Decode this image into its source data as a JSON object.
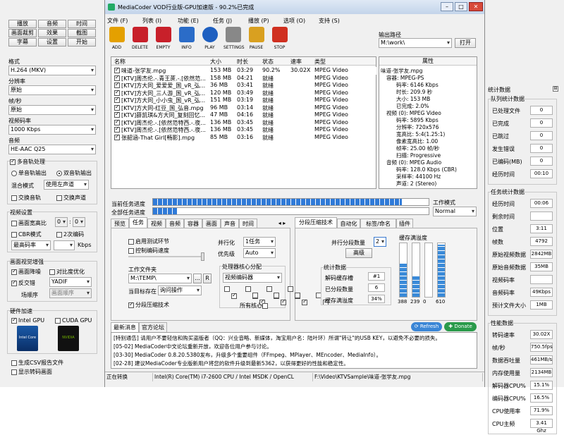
{
  "window": {
    "title": "MediaCoder VOD行业版-GPU加速版 - 90.2%已完成"
  },
  "left_buttons": [
    [
      "播放",
      "音频",
      "时间"
    ],
    [
      "画面裁剪",
      "效果",
      "截图"
    ],
    [
      "字幕",
      "设置",
      "开始"
    ]
  ],
  "format": {
    "label": "格式",
    "value": "H.264 (MKV)"
  },
  "resolution": {
    "label": "分辨率",
    "value": "原始"
  },
  "framerate": {
    "label": "帧/秒",
    "value": "原始"
  },
  "video_bitrate": {
    "label": "视频码率",
    "value": "1000 Kbps"
  },
  "audio": {
    "label": "音频",
    "value": "HE-AAC Q25"
  },
  "multitask": {
    "label": "多音轨处理",
    "single": "单音轨输出",
    "dual": "双音轨输出",
    "mix_label": "混合模式",
    "mix_value": "使用左声道",
    "swap_channel": "交换音轨",
    "swap_ch2": "交换声道"
  },
  "video_settings": {
    "title": "视频设置",
    "ratio": "画面宽高比",
    "ratio_a": "0",
    "ratio_b": "0",
    "cbr": "CBR模式",
    "pass2": "2次编码",
    "max_bitrate": "最高码率",
    "kbps": "Kbps"
  },
  "enhance": {
    "title": "画面视觉增强",
    "denoise": "画面降噪",
    "contrast": "对比度优化",
    "deinterlace": "反交错",
    "deint_value": "YADIF",
    "field_order": "场顺序",
    "field_value": "画面顺序"
  },
  "hw": {
    "title": "硬件加速",
    "intel": "Intel GPU",
    "cuda": "CUDA GPU",
    "intel_badge": "Intel Core",
    "nvidia_badge": "NVIDIA"
  },
  "bottom_left": {
    "csv": "生成CSV报告文件",
    "show": "显示转码画面"
  },
  "menu": [
    "文件 (F)",
    "列表 (I)",
    "功能 (E)",
    "任务 (J)",
    "播放 (P)",
    "选项 (O)",
    "支持 (S)"
  ],
  "toolbar": [
    "ADD",
    "DELETE",
    "EMPTY",
    "INFO",
    "PLAY",
    "SETTINGS",
    "PAUSE",
    "STOP"
  ],
  "output": {
    "label": "输出路径",
    "value": "M:\\work\\",
    "open": "打开"
  },
  "list_headers": [
    "名称",
    "大小",
    "时长",
    "状态",
    "速率",
    "类型"
  ],
  "files": [
    [
      "味道-张学友.mpg",
      "153 MB",
      "03:29",
      "90.2%",
      "30.02X",
      "MPEG Video"
    ],
    [
      "[KTV]周杰伦.-.青王蔗.-.[依然范...",
      "158 MB",
      "04:21",
      "就绪",
      "",
      "MPEG Video"
    ],
    [
      "[KTV]方大同_爱爱爱_国_vR_弘...",
      "36 MB",
      "03:41",
      "就绪",
      "",
      "MPEG Video"
    ],
    [
      "[KTV]方大同_三人游_国_vR_弘...",
      "120 MB",
      "03:49",
      "就绪",
      "",
      "MPEG Video"
    ],
    [
      "[KTV]方大同_小小虫_国_vR_弘...",
      "151 MB",
      "03:19",
      "就绪",
      "",
      "MPEG Video"
    ],
    [
      "[KTV]方大同-红豆_国_弘音.mpg",
      "96 MB",
      "03:14",
      "就绪",
      "",
      "MPEG Video"
    ],
    [
      "[KTV]薛凯琪&方大同_复刻回忆...",
      "47 MB",
      "04:16",
      "就绪",
      "",
      "MPEG Video"
    ],
    [
      "[KTV]周杰伦.-.[依然范特西.-.夜...",
      "136 MB",
      "03:45",
      "就绪",
      "",
      "MPEG Video"
    ],
    [
      "[KTV]周杰伦.-.[依然范特西.-.夜...",
      "136 MB",
      "03:45",
      "就绪",
      "",
      "MPEG Video"
    ],
    [
      "张韶涵-That Girl[畅影].mpg",
      "85 MB",
      "03:16",
      "就绪",
      "",
      "MPEG Video"
    ]
  ],
  "props": {
    "title": "属性",
    "lines": [
      "味道-张学友.mpg",
      "容器: MPEG-PS",
      "码率: 6146 Kbps",
      "时长: 209.9 秒",
      "大小: 153 MB",
      "已完成: 2.0%",
      "视频 (0): MPEG Video",
      "码率: 5895 Kbps",
      "分辨率: 720x576",
      "宽高比: 5:4(1.25:1)",
      "像素宽高比: 1.00",
      "帧率: 25.00 帧/秒",
      "扫描: Progressive",
      "音频 (0): MPEG Audio",
      "码率: 128.0 Kbps (CBR)",
      "采样率: 44100 Hz",
      "声道: 2 (Stereo)"
    ]
  },
  "progress": {
    "current_label": "当前任务进度",
    "current": 0.902,
    "total_label": "全部任务进度",
    "total": 0.09,
    "mode_label": "工作模式",
    "mode_value": "Normal"
  },
  "tabs_left": [
    "预览",
    "任务",
    "视频",
    "音频",
    "容器",
    "画面",
    "声音",
    "时间"
  ],
  "tabs_right": [
    "分段压缩技术",
    "自动化",
    "标签/命名",
    "插件"
  ],
  "task": {
    "test": "启用测试环节",
    "ctrl": "控制编码速度",
    "parallel": "并行化",
    "parallel_v": "1任务",
    "priority": "优先级",
    "priority_v": "Auto",
    "workdir_label": "工作文件夹",
    "workdir": "M:\\TEMP\\",
    "browse": "...",
    "r": "R",
    "when_done_label": "当目标存在",
    "when_done": "询问操作",
    "seg": "分段压缩技术",
    "cpu_group": "处理器核心分配",
    "cpu_v": "视频编码器",
    "all_cores": "所有核心"
  },
  "seg": {
    "parallel_label": "并行分段数量",
    "parallel_v": "2",
    "advanced": "高级",
    "buffer_label": "缓存满溢度",
    "stats_title": "统计数据",
    "decode_buf": "解码缓存槽",
    "decode_v": "#1",
    "segments": "已分段数量",
    "segments_v": "6",
    "overflow": "缓存满溢度",
    "overflow_v": "34%",
    "bars": [
      388,
      239,
      0,
      610
    ],
    "bar_fill": [
      0.62,
      0.38,
      0,
      0.97
    ]
  },
  "news": {
    "tabs": [
      "最新消息",
      "官方论坛"
    ],
    "refresh": "Refresh",
    "donate": "Donate",
    "lines": [
      "[特别通告] 请用户不要轻信和购买盗版者（QQ：兴业音略、新媒体，淘宝用户名：陆叶环）所谓\"转让\"的USB KEY，以避免不必要的损失。",
      "[05-02] MediaCoder中文论坛重新开放，欢迎各位用户参与讨论。",
      "[03-30] MediaCoder 0.8.20.5380发布，升级多个重要组件（FFmpeg、MPlayer、MEncoder、MediaInfo）。",
      "[02-28] 建议MediaCoder专业版新用户将您的软件升级到最新5362，以获得更好的性能和稳定性。"
    ]
  },
  "status": [
    "正在转换",
    "Intel(R) Core(TM) i7-2600 CPU  /  Intel MSDK / OpenCL",
    "F:\\Video\\KTVSample\\味道-张学友.mpg"
  ],
  "stats": {
    "title": "统计数据",
    "g1": "队列统计数据",
    "g1_rows": [
      [
        "已处理文件",
        "0"
      ],
      [
        "已完成",
        "0"
      ],
      [
        "已跳过",
        "0"
      ],
      [
        "发生错误",
        "0"
      ],
      [
        "已编码(MB)",
        "0"
      ],
      [
        "经历时间",
        "00:10"
      ]
    ],
    "g2": "任务统计数据",
    "g2_rows": [
      [
        "经历时间",
        "00:06"
      ],
      [
        "剩余时间",
        ""
      ],
      [
        "位置",
        "3:11"
      ],
      [
        "帧数",
        "4792"
      ],
      [
        "原始视频数据",
        "2842MB"
      ],
      [
        "原始音频数据",
        "35MB"
      ],
      [
        "视频码率",
        ""
      ],
      [
        "音频码率",
        "49Kbps"
      ],
      [
        "预计文件大小",
        "1MB"
      ]
    ],
    "g3": "性能数据",
    "g3_rows": [
      [
        "转码速率",
        "30.02X"
      ],
      [
        "帧/秒",
        "750.5fps"
      ],
      [
        "数据吞吐量",
        "461MB/s"
      ],
      [
        "内存使用量",
        "2134MB"
      ],
      [
        "解码器CPU%",
        "15.1%"
      ],
      [
        "编码器CPU%",
        "16.5%"
      ],
      [
        "CPU使用率",
        "71.9%"
      ],
      [
        "CPU主频",
        "3.41 Ghz"
      ]
    ]
  },
  "colors": {
    "progress": "#2f7ad8",
    "tool_add": "#e4a000",
    "tool_del": "#c8202a",
    "tool_info": "#2b6cc8",
    "tool_play": "#1e5fc0",
    "tool_set": "#888888",
    "tool_pause": "#d9a020",
    "tool_stop": "#d03020"
  }
}
